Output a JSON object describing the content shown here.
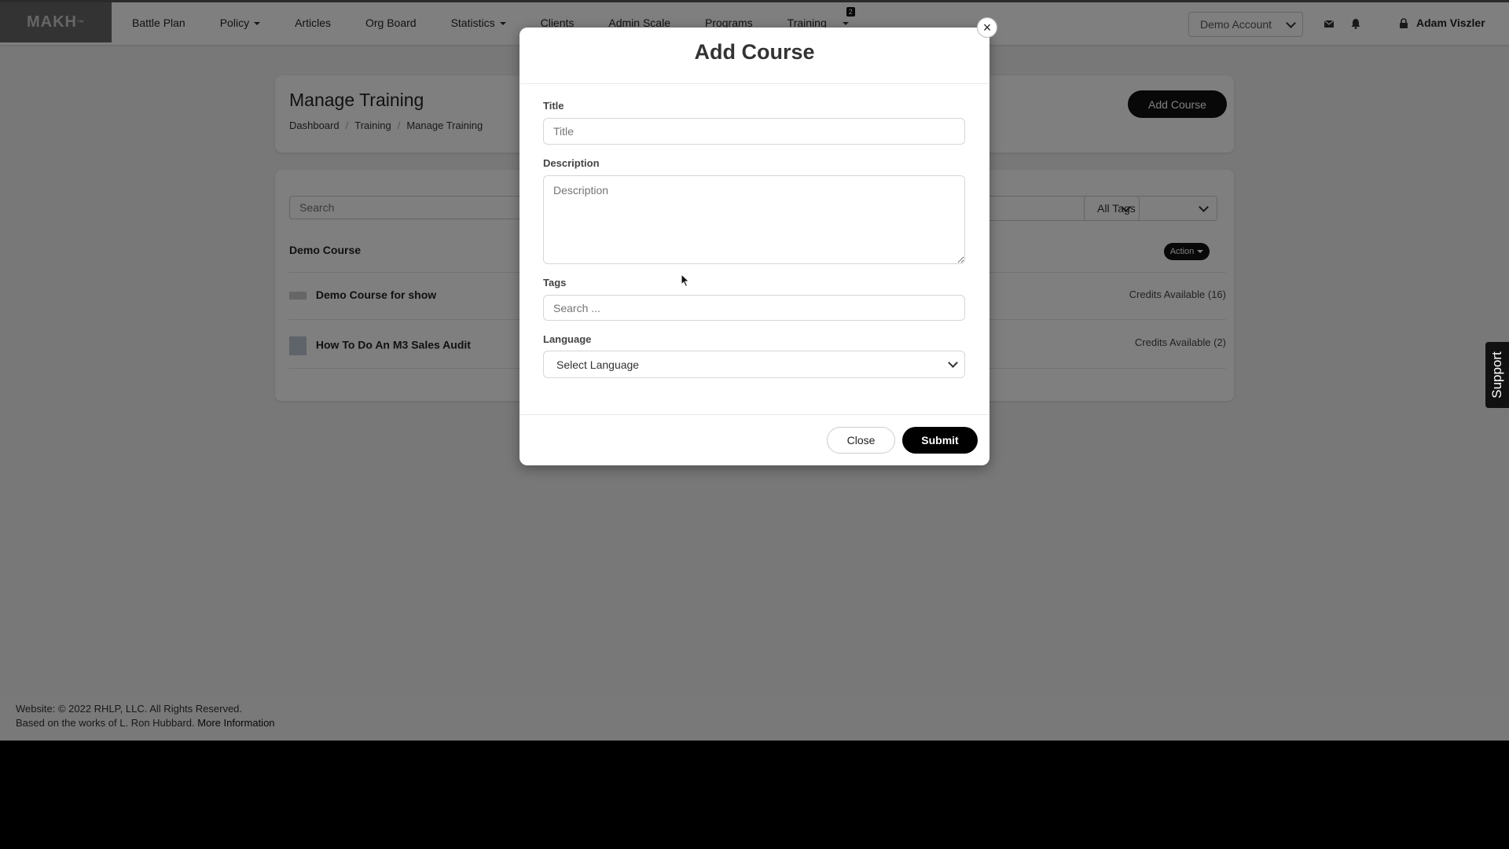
{
  "logo": {
    "text": "MAKH",
    "mark": "™"
  },
  "nav": {
    "items": [
      {
        "label": "Battle Plan",
        "dropdown": false
      },
      {
        "label": "Policy",
        "dropdown": true
      },
      {
        "label": "Articles",
        "dropdown": false
      },
      {
        "label": "Org Board",
        "dropdown": false
      },
      {
        "label": "Statistics",
        "dropdown": true
      },
      {
        "label": "Clients",
        "dropdown": false
      },
      {
        "label": "Admin Scale",
        "dropdown": false
      },
      {
        "label": "Programs",
        "dropdown": false
      }
    ],
    "training": {
      "label": "Training",
      "badge": "2"
    }
  },
  "account": {
    "selected": "Demo Account",
    "user_name": "Adam Viszler"
  },
  "icons": {
    "mail": "envelope-icon",
    "notifications": "bell-icon",
    "user": "lock-icon",
    "close": "close-icon"
  },
  "page": {
    "title": "Manage Training",
    "breadcrumb": [
      "Dashboard",
      "Training",
      "Manage Training"
    ],
    "add_course_label": "Add Course",
    "search_placeholder": "Search",
    "tags_filter": "All Tags",
    "course_group": "Demo Course",
    "action_label": "Action",
    "courses": [
      {
        "name": "Demo Course for show",
        "credits": "Credits Available (16)"
      },
      {
        "name": "How To Do An M3 Sales Audit",
        "credits": "Credits Available (2)"
      }
    ]
  },
  "modal": {
    "title": "Add Course",
    "title_label": "Title",
    "title_placeholder": "Title",
    "description_label": "Description",
    "description_placeholder": "Description",
    "tags_label": "Tags",
    "tags_placeholder": "Search ...",
    "language_label": "Language",
    "language_selected": "Select Language",
    "close_label": "Close",
    "submit_label": "Submit"
  },
  "footer": {
    "line1": "Website: © 2022 RHLP, LLC. All Rights Reserved.",
    "line2": "Based on the works of L. Ron Hubbard.",
    "more_link": "More Information"
  },
  "support_label": "Support",
  "colors": {
    "primary_button": "#000000",
    "overlay": "rgba(0,0,0,0.5)",
    "logo_bg": "#666666"
  }
}
